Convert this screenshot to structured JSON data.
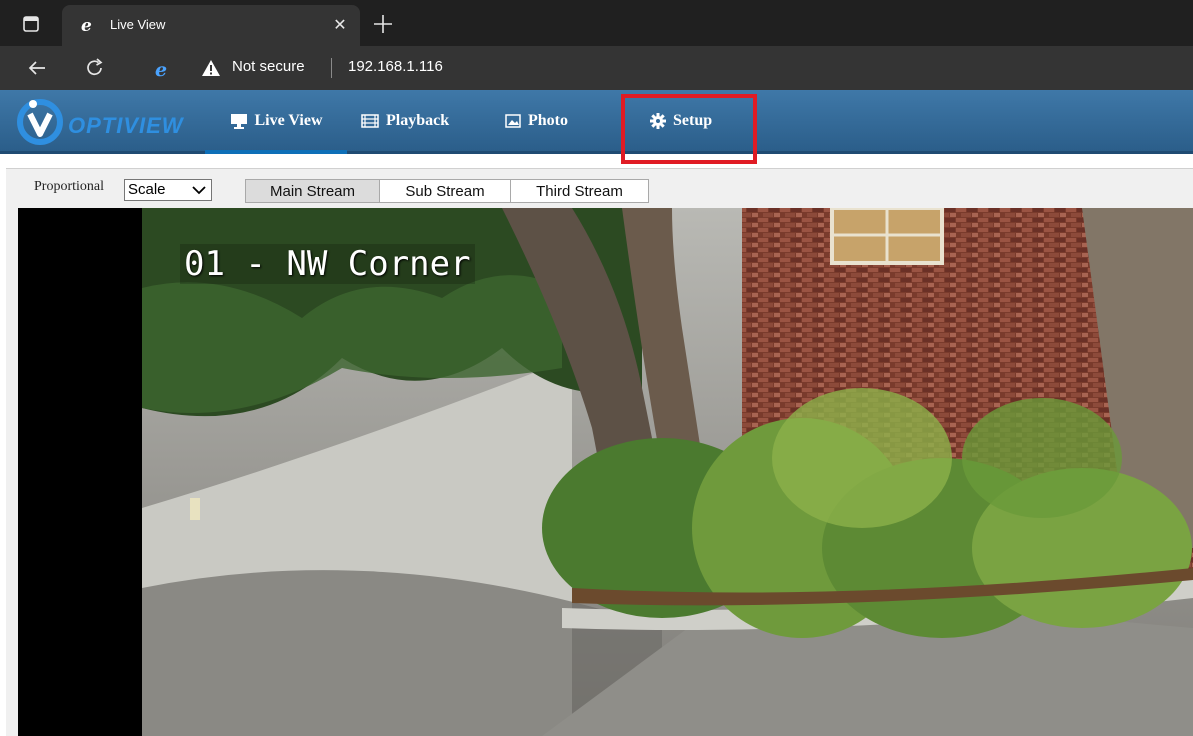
{
  "browser": {
    "tab": {
      "title": "Live View"
    },
    "address": {
      "security_label": "Not secure",
      "url": "192.168.1.116"
    }
  },
  "app": {
    "logo_text": "OPTIVIEW",
    "nav": [
      {
        "label": "Live View",
        "icon": "monitor-icon",
        "active": true
      },
      {
        "label": "Playback",
        "icon": "film-icon",
        "active": false
      },
      {
        "label": "Photo",
        "icon": "photo-icon",
        "active": false
      },
      {
        "label": "Setup",
        "icon": "gear-icon",
        "active": false,
        "highlighted": true
      }
    ],
    "accent": "#2f8fe0",
    "highlight_color": "#e01b24"
  },
  "toolbar": {
    "proportion_label": "Proportional",
    "scale_value": "Scale",
    "streams": [
      {
        "label": "Main Stream",
        "selected": true
      },
      {
        "label": "Sub Stream",
        "selected": false
      },
      {
        "label": "Third Stream",
        "selected": false
      }
    ]
  },
  "video": {
    "osd_text": "01 - NW Corner"
  }
}
